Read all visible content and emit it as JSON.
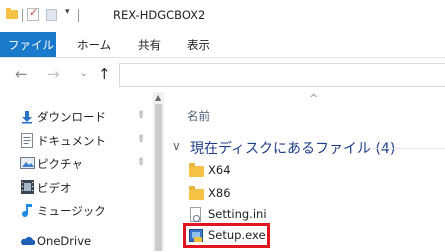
{
  "window": {
    "title": "REX-HDGCBOX2"
  },
  "quick_access": {
    "icons": [
      "folder-icon",
      "properties-check-icon",
      "new-folder-icon",
      "customize-dropdown-icon"
    ],
    "dropdown_glyph": "▾"
  },
  "ribbon": {
    "tabs": [
      {
        "label": "ファイル",
        "active": true
      },
      {
        "label": "ホーム"
      },
      {
        "label": "共有"
      },
      {
        "label": "表示"
      }
    ],
    "active_color": "#1979ca"
  },
  "navigation": {
    "back_glyph": "←",
    "forward_glyph": "→",
    "recent_glyph": "⌄",
    "up_glyph": "↑"
  },
  "nav_pane": {
    "items": [
      {
        "label": "ダウンロード",
        "icon": "download-arrow-icon",
        "pinned": true
      },
      {
        "label": "ドキュメント",
        "icon": "document-icon",
        "pinned": true
      },
      {
        "label": "ピクチャ",
        "icon": "pictures-icon",
        "pinned": true
      },
      {
        "label": "ビデオ",
        "icon": "video-icon",
        "pinned": false
      },
      {
        "label": "ミュージック",
        "icon": "music-note-icon",
        "pinned": false
      },
      {
        "label": "OneDrive",
        "icon": "onedrive-cloud-icon",
        "pinned": false
      }
    ],
    "pin_glyph": "📌"
  },
  "content": {
    "column_header": "名前",
    "sort_glyph": "^",
    "group": {
      "chevron": "∨",
      "title": "現在ディスクにあるファイル (4)"
    },
    "files": [
      {
        "name": "X64",
        "type": "folder"
      },
      {
        "name": "X86",
        "type": "folder"
      },
      {
        "name": "Setting.ini",
        "type": "ini"
      },
      {
        "name": "Setup.exe",
        "type": "exe",
        "highlighted": true
      }
    ],
    "highlight_color": "#e0151f"
  }
}
